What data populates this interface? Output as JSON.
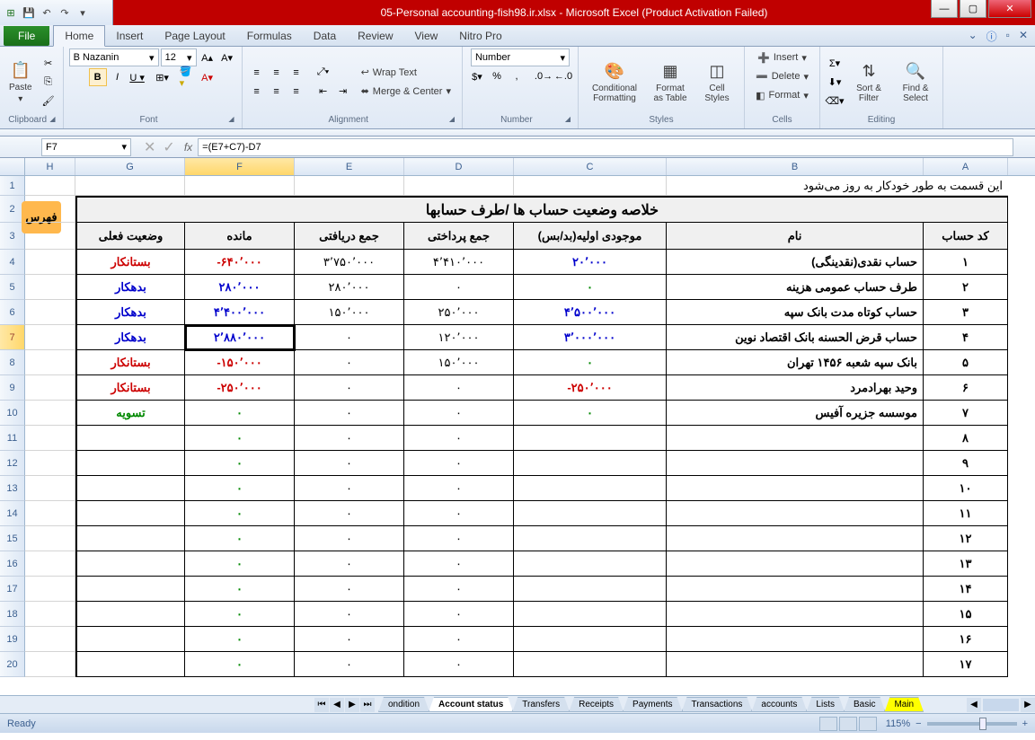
{
  "title": "05-Personal accounting-fish98.ir.xlsx - Microsoft Excel (Product Activation Failed)",
  "tabs": {
    "file": "File",
    "home": "Home",
    "insert": "Insert",
    "pagelayout": "Page Layout",
    "formulas": "Formulas",
    "data": "Data",
    "review": "Review",
    "view": "View",
    "nitro": "Nitro Pro"
  },
  "ribbon": {
    "clipboard": {
      "label": "Clipboard",
      "paste": "Paste"
    },
    "font": {
      "label": "Font",
      "name": "B Nazanin",
      "size": "12"
    },
    "alignment": {
      "label": "Alignment",
      "wrap": "Wrap Text",
      "merge": "Merge & Center"
    },
    "number": {
      "label": "Number",
      "format": "Number"
    },
    "styles": {
      "label": "Styles",
      "cond": "Conditional Formatting",
      "table": "Format as Table",
      "cell": "Cell Styles"
    },
    "cells": {
      "label": "Cells",
      "insert": "Insert",
      "delete": "Delete",
      "format": "Format"
    },
    "editing": {
      "label": "Editing",
      "sort": "Sort & Filter",
      "find": "Find & Select"
    }
  },
  "namebox": "F7",
  "formula": "=(E7+C7)-D7",
  "cols": [
    "H",
    "G",
    "F",
    "E",
    "D",
    "C",
    "B",
    "A"
  ],
  "row1_note": "این قسمت به طور خودکار به روز می‌شود",
  "title_row": "خلاصه وضعیت حساب ها /طرف حسابها",
  "headers": {
    "g": "وضعیت فعلی",
    "f": "مانده",
    "e": "جمع دریافتی",
    "d": "جمع پرداختی",
    "c": "موجودی اولیه(بد/بس)",
    "b": "نام",
    "a": "کد حساب"
  },
  "side_button": "فهرس",
  "rows": [
    {
      "r": 4,
      "a": "۱",
      "b": "حساب نقدی(نقدینگی)",
      "c": "۲۰٬۰۰۰",
      "cc": "blue",
      "d": "۴٬۴۱۰٬۰۰۰",
      "e": "۳٬۷۵۰٬۰۰۰",
      "f": "۶۴۰٬۰۰۰-",
      "fc": "red",
      "g": "بستانکار",
      "gc": "red"
    },
    {
      "r": 5,
      "a": "۲",
      "b": "طرف حساب عمومی هزینه",
      "c": "۰",
      "cc": "green",
      "d": "۰",
      "e": "۲۸۰٬۰۰۰",
      "f": "۲۸۰٬۰۰۰",
      "fc": "blue",
      "g": "بدهکار",
      "gc": "blue"
    },
    {
      "r": 6,
      "a": "۳",
      "b": "حساب کوتاه مدت بانک سپه",
      "c": "۴٬۵۰۰٬۰۰۰",
      "cc": "blue",
      "d": "۲۵۰٬۰۰۰",
      "e": "۱۵۰٬۰۰۰",
      "f": "۴٬۴۰۰٬۰۰۰",
      "fc": "blue",
      "g": "بدهکار",
      "gc": "blue"
    },
    {
      "r": 7,
      "a": "۴",
      "b": "حساب قرض الحسنه بانک اقتصاد نوین",
      "c": "۳٬۰۰۰٬۰۰۰",
      "cc": "blue",
      "d": "۱۲۰٬۰۰۰",
      "e": "۰",
      "f": "۲٬۸۸۰٬۰۰۰",
      "fc": "blue",
      "g": "بدهکار",
      "gc": "blue",
      "active": true
    },
    {
      "r": 8,
      "a": "۵",
      "b": "بانک سپه شعبه ۱۴۵۶ تهران",
      "c": "۰",
      "cc": "green",
      "d": "۱۵۰٬۰۰۰",
      "e": "۰",
      "f": "۱۵۰٬۰۰۰-",
      "fc": "red",
      "g": "بستانکار",
      "gc": "red"
    },
    {
      "r": 9,
      "a": "۶",
      "b": "وحید بهرادمرد",
      "c": "۲۵۰٬۰۰۰-",
      "cc": "red",
      "d": "۰",
      "e": "۰",
      "f": "۲۵۰٬۰۰۰-",
      "fc": "red",
      "g": "بستانکار",
      "gc": "red"
    },
    {
      "r": 10,
      "a": "۷",
      "b": "موسسه جزیره آفیس",
      "c": "۰",
      "cc": "green",
      "d": "۰",
      "e": "۰",
      "f": "۰",
      "fc": "green",
      "g": "تسویه",
      "gc": "green"
    },
    {
      "r": 11,
      "a": "۸",
      "b": "",
      "c": "",
      "d": "۰",
      "e": "۰",
      "f": "۰",
      "fc": "green",
      "g": ""
    },
    {
      "r": 12,
      "a": "۹",
      "b": "",
      "c": "",
      "d": "۰",
      "e": "۰",
      "f": "۰",
      "fc": "green",
      "g": ""
    },
    {
      "r": 13,
      "a": "۱۰",
      "b": "",
      "c": "",
      "d": "۰",
      "e": "۰",
      "f": "۰",
      "fc": "green",
      "g": ""
    },
    {
      "r": 14,
      "a": "۱۱",
      "b": "",
      "c": "",
      "d": "۰",
      "e": "۰",
      "f": "۰",
      "fc": "green",
      "g": ""
    },
    {
      "r": 15,
      "a": "۱۲",
      "b": "",
      "c": "",
      "d": "۰",
      "e": "۰",
      "f": "۰",
      "fc": "green",
      "g": ""
    },
    {
      "r": 16,
      "a": "۱۳",
      "b": "",
      "c": "",
      "d": "۰",
      "e": "۰",
      "f": "۰",
      "fc": "green",
      "g": ""
    },
    {
      "r": 17,
      "a": "۱۴",
      "b": "",
      "c": "",
      "d": "۰",
      "e": "۰",
      "f": "۰",
      "fc": "green",
      "g": ""
    },
    {
      "r": 18,
      "a": "۱۵",
      "b": "",
      "c": "",
      "d": "۰",
      "e": "۰",
      "f": "۰",
      "fc": "green",
      "g": ""
    },
    {
      "r": 19,
      "a": "۱۶",
      "b": "",
      "c": "",
      "d": "۰",
      "e": "۰",
      "f": "۰",
      "fc": "green",
      "g": ""
    },
    {
      "r": 20,
      "a": "۱۷",
      "b": "",
      "c": "",
      "d": "۰",
      "e": "۰",
      "f": "۰",
      "fc": "green",
      "g": ""
    }
  ],
  "sheets": [
    "ondition",
    "Account status",
    "Transfers",
    "Receipts",
    "Payments",
    "Transactions",
    "accounts",
    "Lists",
    "Basic",
    "Main"
  ],
  "active_sheet": "Account status",
  "status": "Ready",
  "zoom": "115%"
}
